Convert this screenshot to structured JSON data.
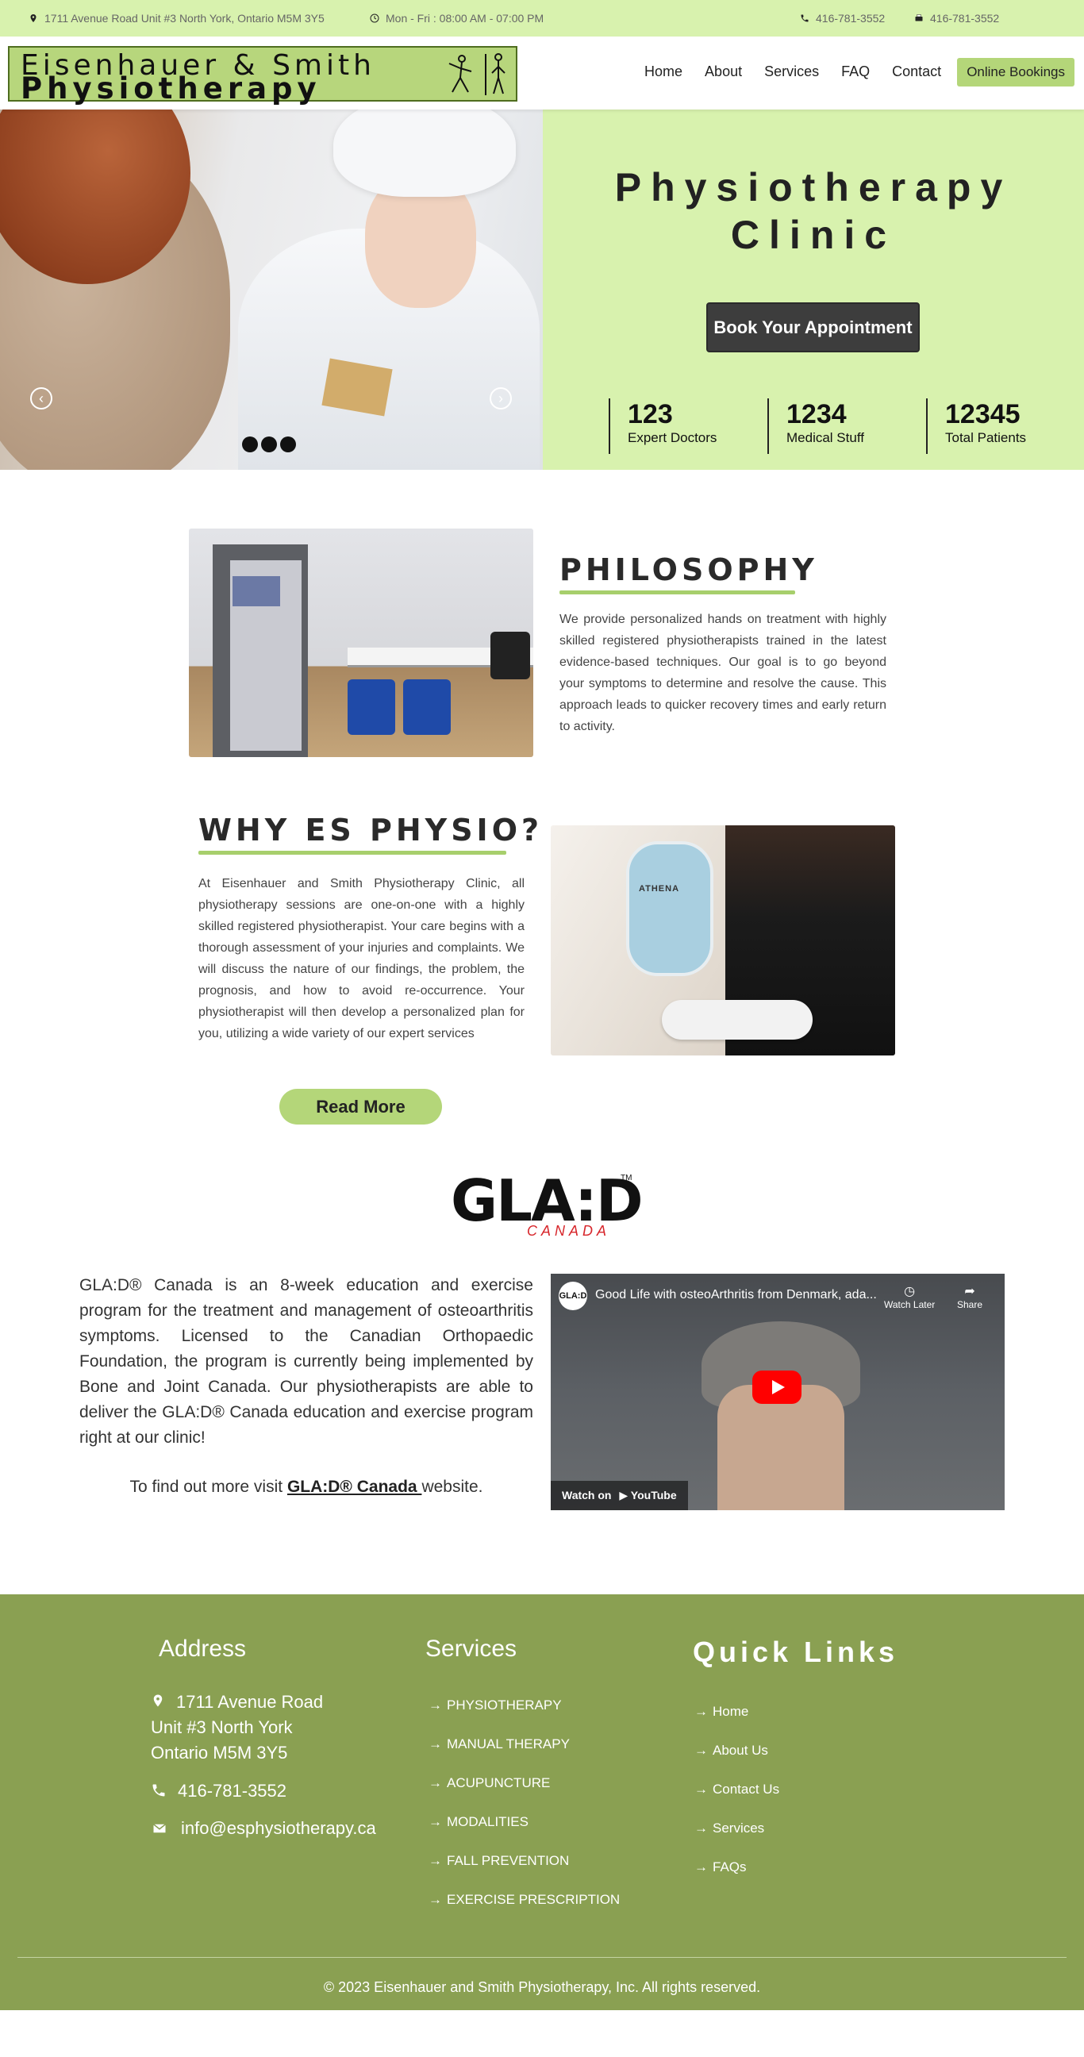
{
  "topbar": {
    "address": "1711 Avenue Road Unit #3 North York, Ontario M5M 3Y5",
    "hours": "Mon - Fri : 08:00 AM - 07:00 PM",
    "phone": "416-781-3552",
    "fax": "416-781-3552"
  },
  "logo": {
    "line1": "Eisenhauer & Smith",
    "line2": "Physiotherapy"
  },
  "nav": {
    "items": [
      "Home",
      "About",
      "Services",
      "FAQ",
      "Contact"
    ],
    "book": "Online Bookings"
  },
  "hero": {
    "title_line1": "Physiotherapy",
    "title_line2": "Clinic",
    "cta": "Book Your Appointment",
    "prev_icon": "arrow-left-circle-icon",
    "next_icon": "arrow-right-circle-icon",
    "slide_count": 3,
    "stats": [
      {
        "num": "123",
        "label": "Expert Doctors"
      },
      {
        "num": "1234",
        "label": "Medical Stuff"
      },
      {
        "num": "12345",
        "label": "Total Patients"
      }
    ]
  },
  "philosophy": {
    "title": "PHILOSOPHY",
    "text": "We provide personalized hands on treatment with highly skilled registered physiotherapists trained in the latest evidence-based techniques. Our goal is to go beyond your symptoms to determine and resolve the cause. This approach leads to quicker recovery times and early return to activity."
  },
  "why": {
    "title": "WHY ES PHYSIO?",
    "text": "At Eisenhauer and Smith Physiotherapy Clinic, all physiotherapy sessions are one-on-one with a highly skilled registered physiotherapist. Your care begins with a thorough assessment of your injuries and complaints. We will discuss the nature of our findings, the problem, the prognosis, and how to avoid re-occurrence. Your physiotherapist will then develop a personalized plan for you, utilizing a wide variety of our expert services",
    "button": "Read More",
    "device_label": "ATHENA"
  },
  "glad": {
    "logo_main": "GLA:D",
    "logo_tm": "TM",
    "logo_sub": "CANADA",
    "text": "GLA:D® Canada is an 8-week education and exercise program for the treatment and management of osteoarthritis symptoms. Licensed to the Canadian Orthopaedic Foundation, the program is currently being implemented by Bone and Joint Canada. Our physiotherapists are able to deliver the GLA:D® Canada education and exercise program right at our clinic!",
    "visit_prefix": "To find out more visit ",
    "visit_link": "GLA:D® Canada ",
    "visit_suffix": "website.",
    "video": {
      "channel": "GLA:D",
      "title": "Good Life with osteoArthritis from Denmark, ada...",
      "watch_later": "Watch Later",
      "share": "Share",
      "watch_on": "Watch on",
      "platform": "YouTube"
    }
  },
  "footer": {
    "address_head": "Address",
    "address_lines": [
      "1711 Avenue Road",
      "Unit #3 North York",
      "Ontario M5M 3Y5"
    ],
    "phone": "416-781-3552",
    "email": "info@esphysiotherapy.ca",
    "services_head": "Services",
    "services": [
      "PHYSIOTHERAPY",
      "MANUAL THERAPY",
      "ACUPUNCTURE",
      "MODALITIES",
      "FALL PREVENTION",
      "EXERCISE PRESCRIPTION"
    ],
    "quick_head": "Quick Links",
    "quick": [
      "Home",
      "About Us",
      "Contact Us",
      "Services",
      "FAQs"
    ],
    "copyright": "© 2023 Eisenhauer and Smith Physiotherapy, Inc. All rights reserved."
  },
  "colors": {
    "accent_light": "#d8f2ae",
    "accent": "#b4d679",
    "footer": "#8aa052",
    "cta_dark": "#3d3d3d"
  }
}
